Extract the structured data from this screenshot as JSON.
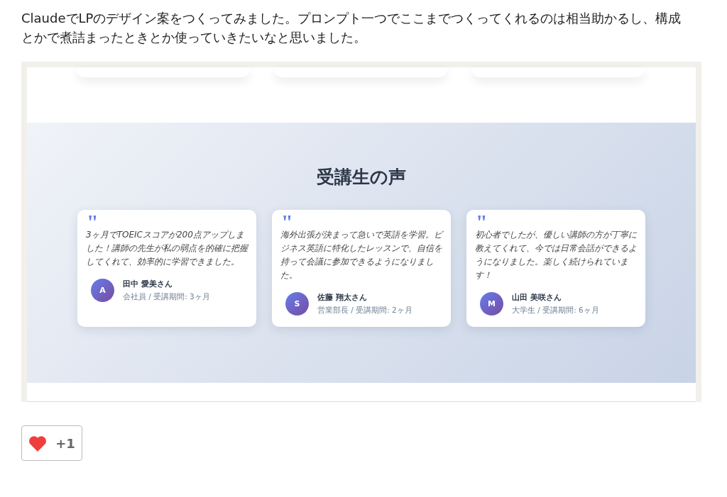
{
  "post": {
    "text": "ClaudeでLPのデザイン案をつくってみました。プロンプト一つでここまでつくってくれるのは相当助かるし、構成とかで煮詰まったときとか使っていきたいなと思いました。"
  },
  "screenshot": {
    "section_title": "受講生の声",
    "testimonials": [
      {
        "mark": "\"",
        "quote": "3ヶ月でTOEICスコアが200点アップしました！講師の先生が私の弱点を的確に把握してくれて、効率的に学習できました。",
        "initial": "A",
        "name": "田中 愛美さん",
        "meta": "会社員 / 受講期間: 3ヶ月"
      },
      {
        "mark": "\"",
        "quote": "海外出張が決まって急いで英語を学習。ビジネス英語に特化したレッスンで、自信を持って会議に参加できるようになりました。",
        "initial": "S",
        "name": "佐藤 翔太さん",
        "meta": "営業部長 / 受講期間: 2ヶ月"
      },
      {
        "mark": "\"",
        "quote": "初心者でしたが、優しい講師の方が丁寧に教えてくれて、今では日常会話ができるようになりました。楽しく続けられています！",
        "initial": "M",
        "name": "山田 美咲さん",
        "meta": "大学生 / 受講期間: 6ヶ月"
      }
    ]
  },
  "reaction": {
    "liked": true,
    "count": "+1"
  }
}
